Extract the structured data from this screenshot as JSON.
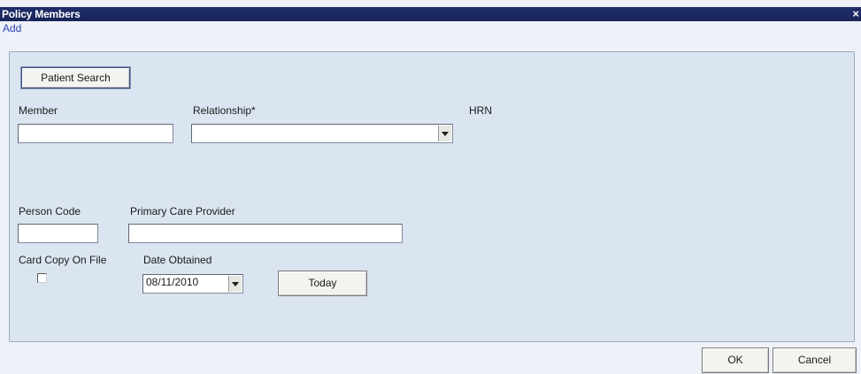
{
  "window": {
    "title": "Policy Members",
    "close_icon": "close-icon"
  },
  "menu": {
    "add_label": "Add"
  },
  "form": {
    "patient_search_label": "Patient Search",
    "member": {
      "label": "Member",
      "value": ""
    },
    "relationship": {
      "label": "Relationship*",
      "value": ""
    },
    "hrn": {
      "label": "HRN"
    },
    "person_code": {
      "label": "Person Code",
      "value": ""
    },
    "primary_care_provider": {
      "label": "Primary Care Provider",
      "value": ""
    },
    "card_copy_on_file": {
      "label": "Card Copy On File",
      "checked": false
    },
    "date_obtained": {
      "label": "Date Obtained",
      "value": "08/11/2010"
    },
    "today_label": "Today"
  },
  "footer": {
    "ok_label": "OK",
    "cancel_label": "Cancel"
  },
  "colors": {
    "titlebar": "#1f2d6a",
    "panel": "#dbe5f1",
    "background": "#eef2f8",
    "menu_link": "#2e44b6"
  }
}
